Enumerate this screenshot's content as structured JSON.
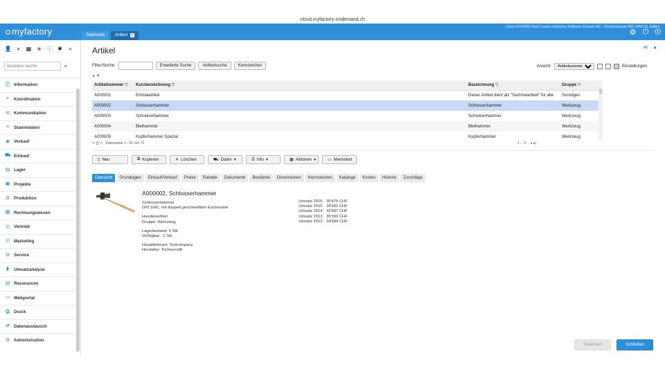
{
  "browser": {
    "url": "cloud.myfactory-ondemand.ch"
  },
  "topbar": {
    "logo": "myfactory",
    "tabs": [
      {
        "label": "Startseite"
      },
      {
        "label": "Artikel"
      }
    ],
    "license": "Lizenz A741405 SaaS Lizenz myfactory Software Schweiz AG - Zürcherstrasse 66b, 9000 St. Gallen",
    "icons": [
      "gear-icon",
      "power-icon",
      "logout-icon"
    ]
  },
  "sidebar": {
    "search_placeholder": "Business Suche",
    "items": [
      {
        "label": "Information"
      },
      {
        "label": "Koordination"
      },
      {
        "label": "Kommunikation"
      },
      {
        "label": "Stammdaten"
      },
      {
        "label": "Verkauf"
      },
      {
        "label": "Einkauf"
      },
      {
        "label": "Lager"
      },
      {
        "label": "Projekte"
      },
      {
        "label": "Produktion"
      },
      {
        "label": "Rechnungswesen"
      },
      {
        "label": "Vertrieb"
      },
      {
        "label": "Marketing"
      },
      {
        "label": "Service"
      },
      {
        "label": "Umsatzanalyse"
      },
      {
        "label": "Ressourcen"
      },
      {
        "label": "Webportal"
      },
      {
        "label": "Druck"
      },
      {
        "label": "Datenaustausch"
      },
      {
        "label": "Administration"
      }
    ]
  },
  "main": {
    "title": "Artikel",
    "filter_label": "Filter/Suche:",
    "filter_value": "",
    "buttons": {
      "extended": "Erweiterte Suche",
      "fulltext": "Volltextsuche",
      "keywords": "Kennzeichen"
    },
    "view_label": "Ansicht:",
    "view_value": "Artikelnummer",
    "settings": "Einstellungen"
  },
  "grid": {
    "columns": [
      "Artikelnummer",
      "Kurzbezeichnung",
      "Bezeichnung",
      "Gruppe"
    ],
    "rows": [
      {
        "nr": "A000001",
        "short": "Einmalartikel",
        "desc": "Dieser Artikel dient als \"Sammelartikel\" für alle",
        "group": "Sonstiges"
      },
      {
        "nr": "A000002",
        "short": "Schlosserhammer",
        "desc": "Schlosserhammer",
        "group": "Werkzeug"
      },
      {
        "nr": "A000003",
        "short": "Schreinerhammer",
        "desc": "Schreinerhammer",
        "group": "Werkzeug"
      },
      {
        "nr": "A000004",
        "short": "Bleihammer",
        "desc": "Bleihammer",
        "group": "Werkzeug"
      },
      {
        "nr": "A000005",
        "short": "Kupferhammer Spezial",
        "desc": "Kupferhammer",
        "group": "Werkzeug"
      }
    ],
    "footer": "Datensätze 1 - 50 von 70",
    "pager": "1 ... 2 ... ▸ ▸|"
  },
  "actions": [
    "Neu",
    "Kopieren",
    "Löschen",
    "Daten",
    "Info",
    "Aktionen",
    "Memotext"
  ],
  "tabs": [
    "Übersicht",
    "Grundlagen",
    "Einkauf/Verkauf",
    "Preise",
    "Rabatte",
    "Dokumente",
    "Bestände",
    "Dimensionen",
    "Kennzeichen",
    "Kataloge",
    "Kosten",
    "Historie",
    "Zuschläge"
  ],
  "detail": {
    "title": "A000002, Schlosserhammer",
    "lines": [
      "Schlosserhammer",
      "DIN 1041, mit doppelt geschweiftem Eschenstiel",
      "",
      "Handelsartikel",
      "Gruppe: Werkzeug",
      "",
      "Lagerbestand: 0 Stk",
      "Verfügbar: -1 Stk",
      "",
      "Hauptlieferant: Toolcompany",
      "Hersteller: Technocraft"
    ],
    "sales": [
      {
        "label": "Umsatz 2016:",
        "value": "35'475 CHF"
      },
      {
        "label": "Umsatz 2015:",
        "value": "34'681 CHF"
      },
      {
        "label": "Umsatz 2014:",
        "value": "42'687 CHF"
      },
      {
        "label": "Umsatz 2013:",
        "value": "39'390 CHF"
      },
      {
        "label": "Umsatz 2012:",
        "value": "34'684 CHF"
      }
    ]
  },
  "footer_buttons": {
    "save": "Speichern",
    "close": "Schließen"
  }
}
